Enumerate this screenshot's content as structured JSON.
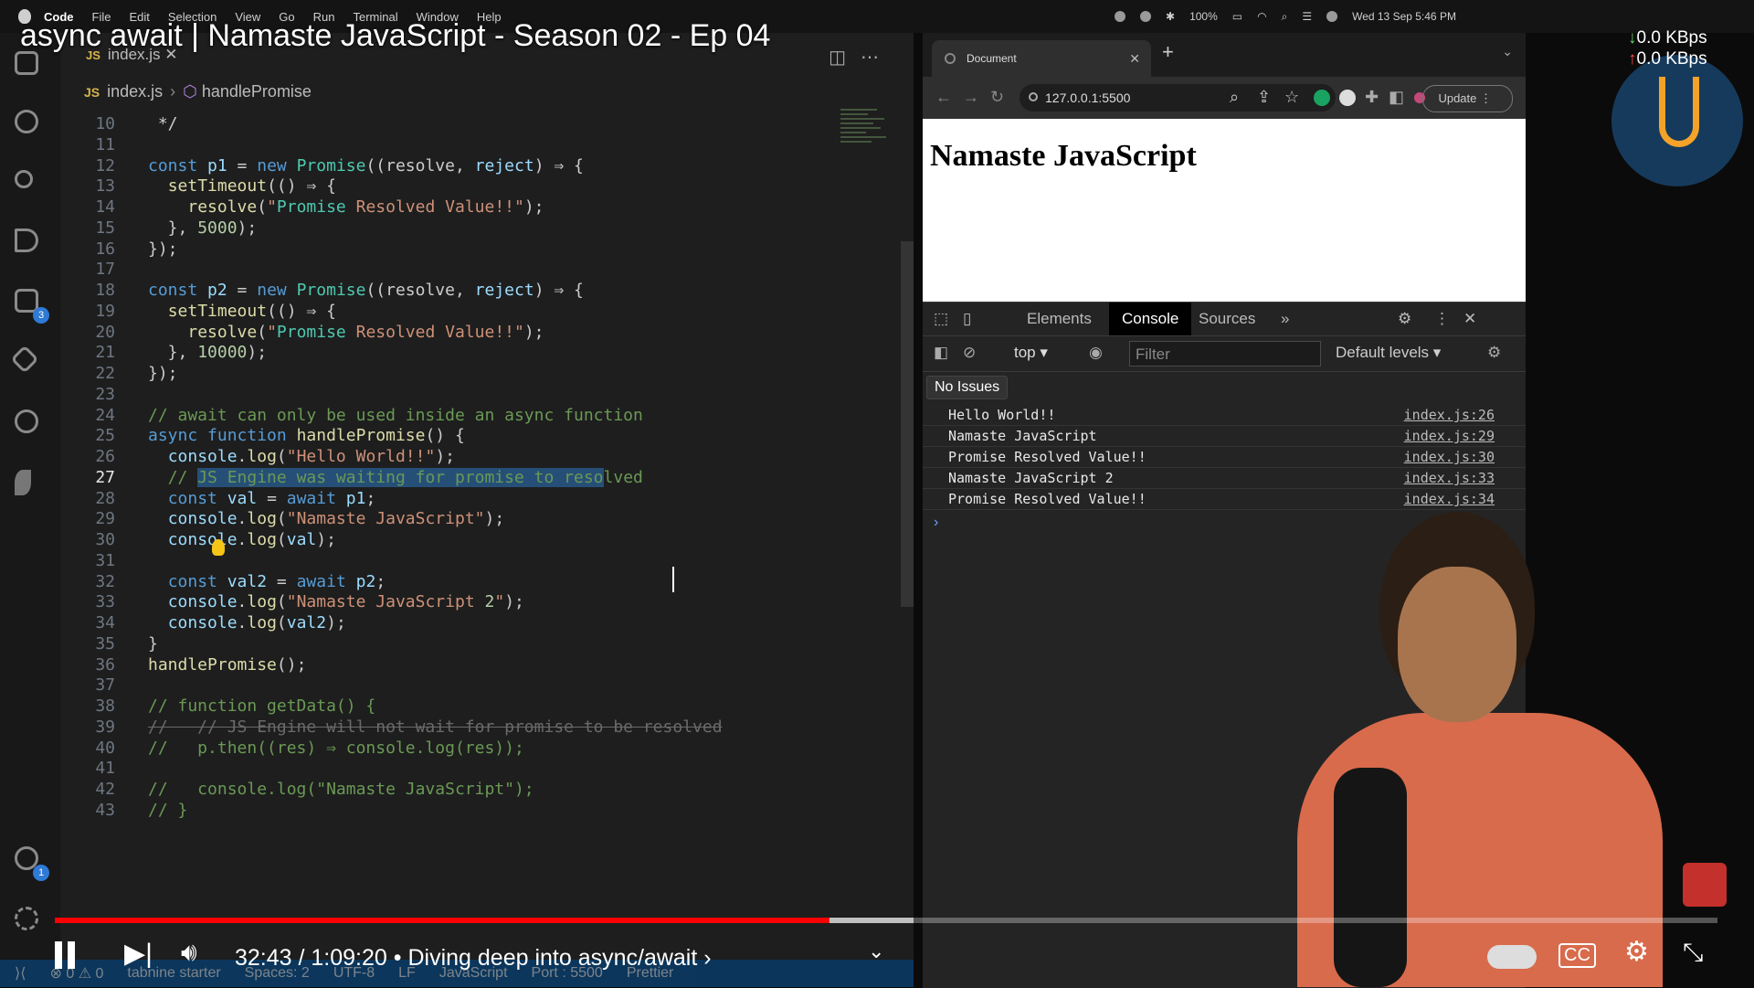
{
  "menubar": {
    "items": [
      "Code",
      "File",
      "Edit",
      "Selection",
      "View",
      "Go",
      "Run",
      "Terminal",
      "Window",
      "Help"
    ],
    "battery": "100%",
    "datetime": "Wed 13 Sep 5:46 PM"
  },
  "video": {
    "title": "async await | Namaste JavaScript - Season 02 - Ep 04",
    "time": "32:43 / 1:09:20",
    "chapter": "• Diving deep into async/await ›",
    "progress_fraction": 0.472
  },
  "netspeed": {
    "down": "0.0 KBps",
    "up": "0.0 KBps"
  },
  "editor": {
    "tab_label": "index.js",
    "breadcrumb_file": "index.js",
    "breadcrumb_symbol": "handlePromise",
    "current_line": 27,
    "lines": [
      {
        "n": 10,
        "text": " */"
      },
      {
        "n": 11,
        "text": ""
      },
      {
        "n": 12,
        "text": "const p1 = new Promise((resolve, reject) ⇒ {"
      },
      {
        "n": 13,
        "text": "  setTimeout(() ⇒ {"
      },
      {
        "n": 14,
        "text": "    resolve(\"Promise Resolved Value!!\");"
      },
      {
        "n": 15,
        "text": "  }, 5000);"
      },
      {
        "n": 16,
        "text": "});"
      },
      {
        "n": 17,
        "text": ""
      },
      {
        "n": 18,
        "text": "const p2 = new Promise((resolve, reject) ⇒ {"
      },
      {
        "n": 19,
        "text": "  setTimeout(() ⇒ {"
      },
      {
        "n": 20,
        "text": "    resolve(\"Promise Resolved Value!!\");"
      },
      {
        "n": 21,
        "text": "  }, 10000);"
      },
      {
        "n": 22,
        "text": "});"
      },
      {
        "n": 23,
        "text": ""
      },
      {
        "n": 24,
        "text": "// await can only be used inside an async function"
      },
      {
        "n": 25,
        "text": "async function handlePromise() {"
      },
      {
        "n": 26,
        "text": "  console.log(\"Hello World!!\");"
      },
      {
        "n": 27,
        "text": "  // JS Engine was waiting for promise to resolved"
      },
      {
        "n": 28,
        "text": "  const val = await p1;"
      },
      {
        "n": 29,
        "text": "  console.log(\"Namaste JavaScript\");"
      },
      {
        "n": 30,
        "text": "  console.log(val);"
      },
      {
        "n": 31,
        "text": ""
      },
      {
        "n": 32,
        "text": "  const val2 = await p2;"
      },
      {
        "n": 33,
        "text": "  console.log(\"Namaste JavaScript 2\");"
      },
      {
        "n": 34,
        "text": "  console.log(val2);"
      },
      {
        "n": 35,
        "text": "}"
      },
      {
        "n": 36,
        "text": "handlePromise();"
      },
      {
        "n": 37,
        "text": ""
      },
      {
        "n": 38,
        "text": "// function getData() {"
      },
      {
        "n": 39,
        "text": "//   // JS Engine will not wait for promise to be resolved"
      },
      {
        "n": 40,
        "text": "//   p.then((res) ⇒ console.log(res));"
      },
      {
        "n": 41,
        "text": ""
      },
      {
        "n": 42,
        "text": "//   console.log(\"Namaste JavaScript\");"
      },
      {
        "n": 43,
        "text": "// }"
      }
    ]
  },
  "activity_badges": {
    "extensions": "3",
    "accounts": "1"
  },
  "statusbar": {
    "errors": "0",
    "warnings": "0",
    "tabnine": "tabnine starter",
    "spaces": "Spaces: 2",
    "encoding": "UTF-8",
    "eol": "LF",
    "language": "JavaScript",
    "port": "Port : 5500",
    "prettier": "Prettier"
  },
  "browser": {
    "tab_title": "Document",
    "url": "127.0.0.1:5500",
    "update_label": "Update",
    "page_heading": "Namaste JavaScript",
    "devtools": {
      "tabs": [
        "Elements",
        "Console",
        "Sources"
      ],
      "active_tab": "Console",
      "context": "top",
      "filter_placeholder": "Filter",
      "levels": "Default levels",
      "issues": "No Issues",
      "logs": [
        {
          "msg": "Hello World!!",
          "src": "index.js:26"
        },
        {
          "msg": "Namaste JavaScript",
          "src": "index.js:29"
        },
        {
          "msg": "Promise Resolved Value!!",
          "src": "index.js:30"
        },
        {
          "msg": "Namaste JavaScript 2",
          "src": "index.js:33"
        },
        {
          "msg": "Promise Resolved Value!!",
          "src": "index.js:34"
        }
      ]
    }
  },
  "colors": {
    "accent": "#ff0000",
    "statusbar": "#0d5a9e",
    "selection": "#264f78"
  }
}
